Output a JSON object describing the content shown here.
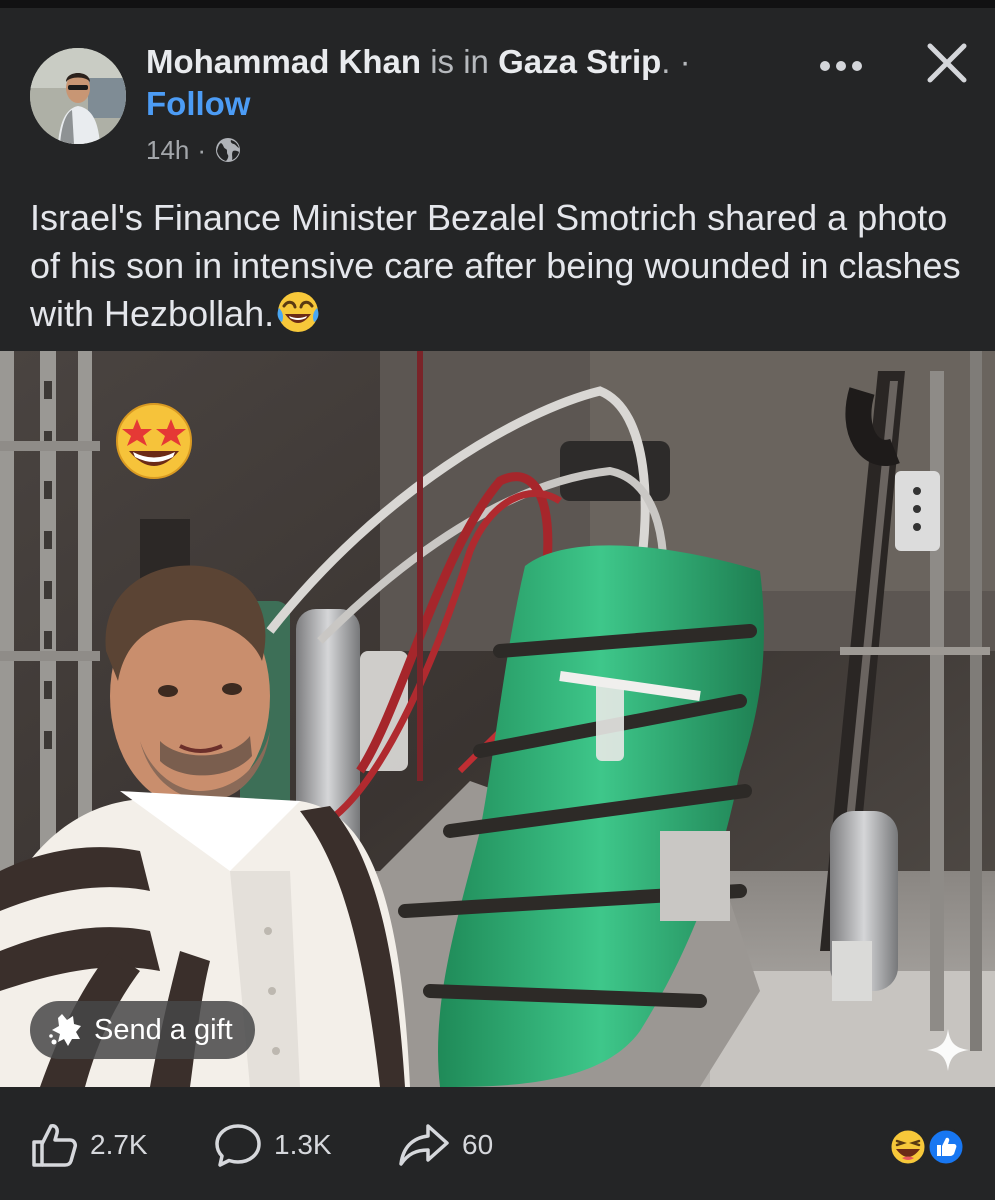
{
  "post": {
    "author_name": "Mohammad Khan",
    "is_in": "is in",
    "location": "Gaza Strip",
    "separator": ". ·",
    "follow_label": "Follow",
    "time": "14h",
    "time_separator": "·",
    "privacy_icon": "globe-icon",
    "text": "Israel's Finance Minister Bezalel Smotrich shared a photo of his son in intensive care after being wounded in clashes with Hezbollah.",
    "text_emoji": "face-with-tears-of-joy-emoji"
  },
  "photo": {
    "overlay_emoji": "star-struck-emoji",
    "gift_label": "Send a gift",
    "gift_icon": "gift-icon"
  },
  "actions": {
    "likes": "2.7K",
    "comments": "1.3K",
    "shares": "60",
    "like_icon": "thumbs-up-icon",
    "comment_icon": "comment-icon",
    "share_icon": "share-icon",
    "reaction_icons": [
      "laughing-reaction-icon",
      "like-reaction-icon"
    ]
  },
  "colors": {
    "background": "#242526",
    "link": "#4c9cf5",
    "text": "#e4e6eb",
    "muted": "#a4a7ab",
    "like_blue": "#1877f2",
    "emoji_yellow": "#f7c83a"
  }
}
